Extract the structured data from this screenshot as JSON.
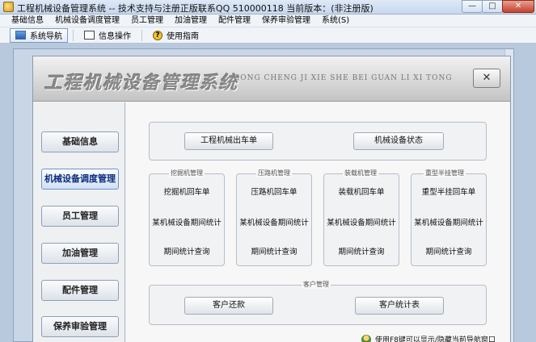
{
  "window": {
    "title": "工程机械设备管理系统 -- 技术支持与注册正版联系QQ 510000118   当前版本：(非注册版)",
    "minimize": "—",
    "maximize": "□",
    "close": "✕"
  },
  "menu": [
    "基础信息",
    "机械设备调度管理",
    "员工管理",
    "加油管理",
    "配件管理",
    "保养审验管理",
    "系统(S)"
  ],
  "toolbar": {
    "nav": "系统导航",
    "info": "信息操作",
    "help": "使用指南",
    "help_glyph": "?"
  },
  "header": {
    "title": "工程机械设备管理系统",
    "pinyin": "GONG CHENG JI XIE SHE BEI GUAN LI XI TONG",
    "close_glyph": "✕"
  },
  "sidebar": {
    "items": [
      "基础信息",
      "机械设备调度管理",
      "员工管理",
      "加油管理",
      "配件管理",
      "保养审验管理"
    ],
    "active_index": 1
  },
  "main": {
    "top_buttons": [
      "工程机械出车单",
      "机械设备状态"
    ],
    "groups": [
      {
        "title": "挖掘机管理",
        "items": [
          "挖掘机回车单",
          "某机械设备期间统计",
          "期间统计查询"
        ]
      },
      {
        "title": "压路机管理",
        "items": [
          "压路机回车单",
          "某机械设备期间统计",
          "期间统计查询"
        ]
      },
      {
        "title": "装载机管理",
        "items": [
          "装载机回车单",
          "某机械设备期间统计",
          "期间统计查询"
        ]
      },
      {
        "title": "重型半挂管理",
        "items": [
          "重型半挂回车单",
          "某机械设备期间统计",
          "期间统计查询"
        ]
      }
    ],
    "customer": {
      "title": "客户管理",
      "buttons": [
        "客户还款",
        "客户统计表"
      ]
    },
    "footer_tip": "使用F8键可以显示/隐藏当前导航窗口"
  }
}
